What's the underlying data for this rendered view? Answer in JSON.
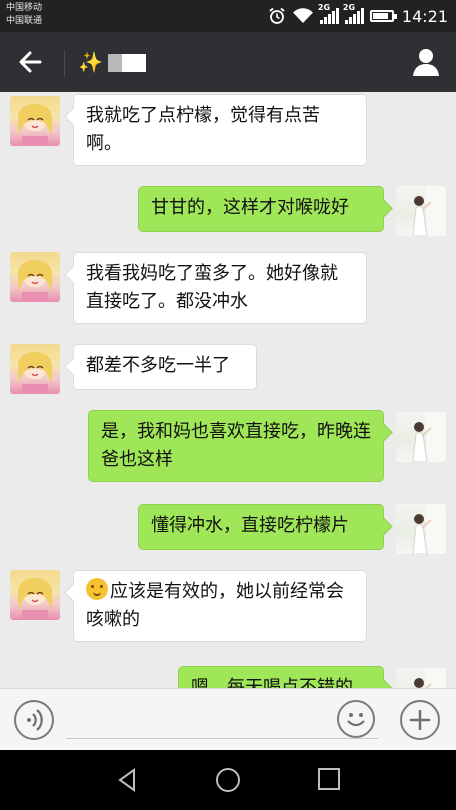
{
  "status_bar": {
    "carrier_1": "中国移动",
    "carrier_2": "中国联通",
    "alarm_icon": "alarm-clock-icon",
    "wifi_icon": "wifi-icon",
    "signal_1_label": "2G",
    "signal_2_label": "2G",
    "battery_icon": "battery-icon",
    "battery_level": 0.85,
    "time": "14:21"
  },
  "header": {
    "back_icon": "arrow-left-icon",
    "title_icon": "sparkles-icon",
    "contact_icon": "person-icon",
    "background_color": "#2e3033"
  },
  "messages": [
    {
      "sender": "other",
      "text": "我就吃了点柠檬，觉得有点苦啊。"
    },
    {
      "sender": "me",
      "text": "甘甘的，这样才对喉咙好"
    },
    {
      "sender": "other",
      "text": "我看我妈吃了蛮多了。她好像就直接吃了。都没冲水"
    },
    {
      "sender": "other",
      "text": "都差不多吃一半了"
    },
    {
      "sender": "me",
      "text": "是，我和妈也喜欢直接吃，昨晚连爸也这样"
    },
    {
      "sender": "me",
      "text": "懂得冲水，直接吃柠檬片"
    },
    {
      "sender": "other",
      "emoji": "thinking-face-emoji",
      "text": "应该是有效的，她以前经常会咳嗽的"
    },
    {
      "sender": "me",
      "text": "嗯，每天喝点不错的"
    }
  ],
  "colors": {
    "incoming_bubble": "#ffffff",
    "outgoing_bubble": "#9fe658",
    "chat_background": "#ebebeb"
  },
  "input_bar": {
    "voice_icon": "voice-input-icon",
    "emoji_icon": "smiley-icon",
    "plus_icon": "plus-icon",
    "input_value": ""
  },
  "nav_bar": {
    "back_icon": "triangle-back-icon",
    "home_icon": "circle-home-icon",
    "recent_icon": "square-recent-icon"
  }
}
